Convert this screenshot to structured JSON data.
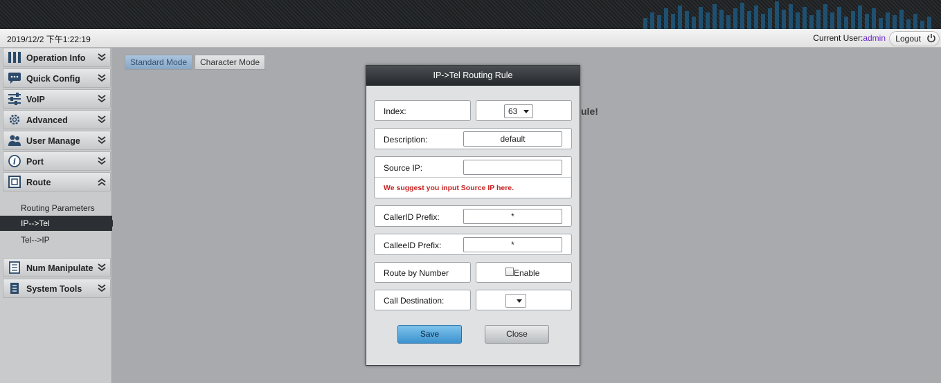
{
  "header": {
    "datetime": "2019/12/2 下午1:22:19",
    "current_user_label": "Current User:",
    "current_user": "admin",
    "logout_label": "Logout"
  },
  "sidebar": {
    "items": [
      {
        "label": "Operation Info",
        "icon": "bars-icon"
      },
      {
        "label": "Quick Config",
        "icon": "chat-icon"
      },
      {
        "label": "VoIP",
        "icon": "sliders-icon"
      },
      {
        "label": "Advanced",
        "icon": "gear-icon"
      },
      {
        "label": "User Manage",
        "icon": "users-icon"
      },
      {
        "label": "Port",
        "icon": "info-icon"
      },
      {
        "label": "Route",
        "icon": "route-icon"
      },
      {
        "label": "Num Manipulate",
        "icon": "notebook-icon"
      },
      {
        "label": "System Tools",
        "icon": "clipboard-icon"
      }
    ],
    "route_sub": [
      "Routing Parameters",
      "IP-->Tel",
      "Tel-->IP"
    ]
  },
  "tabs": {
    "standard": "Standard Mode",
    "character": "Character Mode"
  },
  "background_message": "ule!",
  "modal": {
    "title": "IP->Tel Routing Rule",
    "index_label": "Index:",
    "index_value": "63",
    "description_label": "Description:",
    "description_value": "default",
    "source_ip_label": "Source IP:",
    "source_ip_value": "",
    "source_ip_hint": "We suggest you input Source IP here.",
    "caller_prefix_label": "CallerID Prefix:",
    "caller_prefix_value": "*",
    "callee_prefix_label": "CalleeID Prefix:",
    "callee_prefix_value": "*",
    "route_by_number_label": "Route by Number",
    "enable_label": "Enable",
    "call_dest_label": "Call Destination:",
    "call_dest_value": "",
    "save_label": "Save",
    "close_label": "Close"
  },
  "colors": {
    "accent_user": "#6a2bc9",
    "hint_red": "#c62020",
    "active_tab": "#87a7c6"
  }
}
